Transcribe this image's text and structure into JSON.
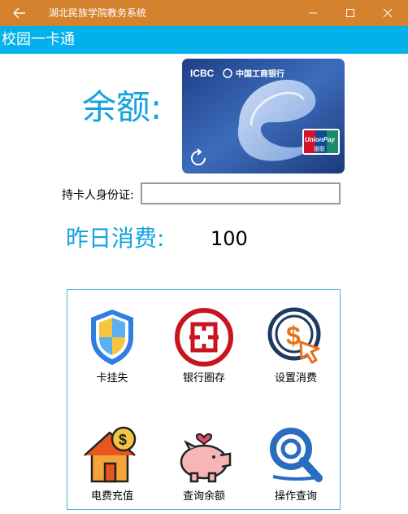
{
  "window": {
    "title": "湖北民族学院教务系统"
  },
  "app": {
    "title": "校园一卡通"
  },
  "balance": {
    "label": "余额:"
  },
  "card": {
    "bank_brand": "ICBC",
    "bank_name": "中国工商银行",
    "network": "UnionPay",
    "network_cn": "银联"
  },
  "id_field": {
    "label": "持卡人身份证:",
    "value": "",
    "placeholder": ""
  },
  "yesterday": {
    "label": "昨日消费:",
    "value": "100"
  },
  "tiles": [
    {
      "label": "卡挂失",
      "icon": "shield-icon"
    },
    {
      "label": "银行圈存",
      "icon": "icbc-logo-icon"
    },
    {
      "label": "设置消费",
      "icon": "dollar-cursor-icon"
    },
    {
      "label": "电费充值",
      "icon": "house-coin-icon"
    },
    {
      "label": "查询余额",
      "icon": "piggy-bank-icon"
    },
    {
      "label": "操作查询",
      "icon": "magnifier-icon"
    }
  ],
  "colors": {
    "titlebar": "#d4822e",
    "appbar": "#03b0ea",
    "accent": "#12a3de",
    "panel_border": "#4bb3d6"
  }
}
